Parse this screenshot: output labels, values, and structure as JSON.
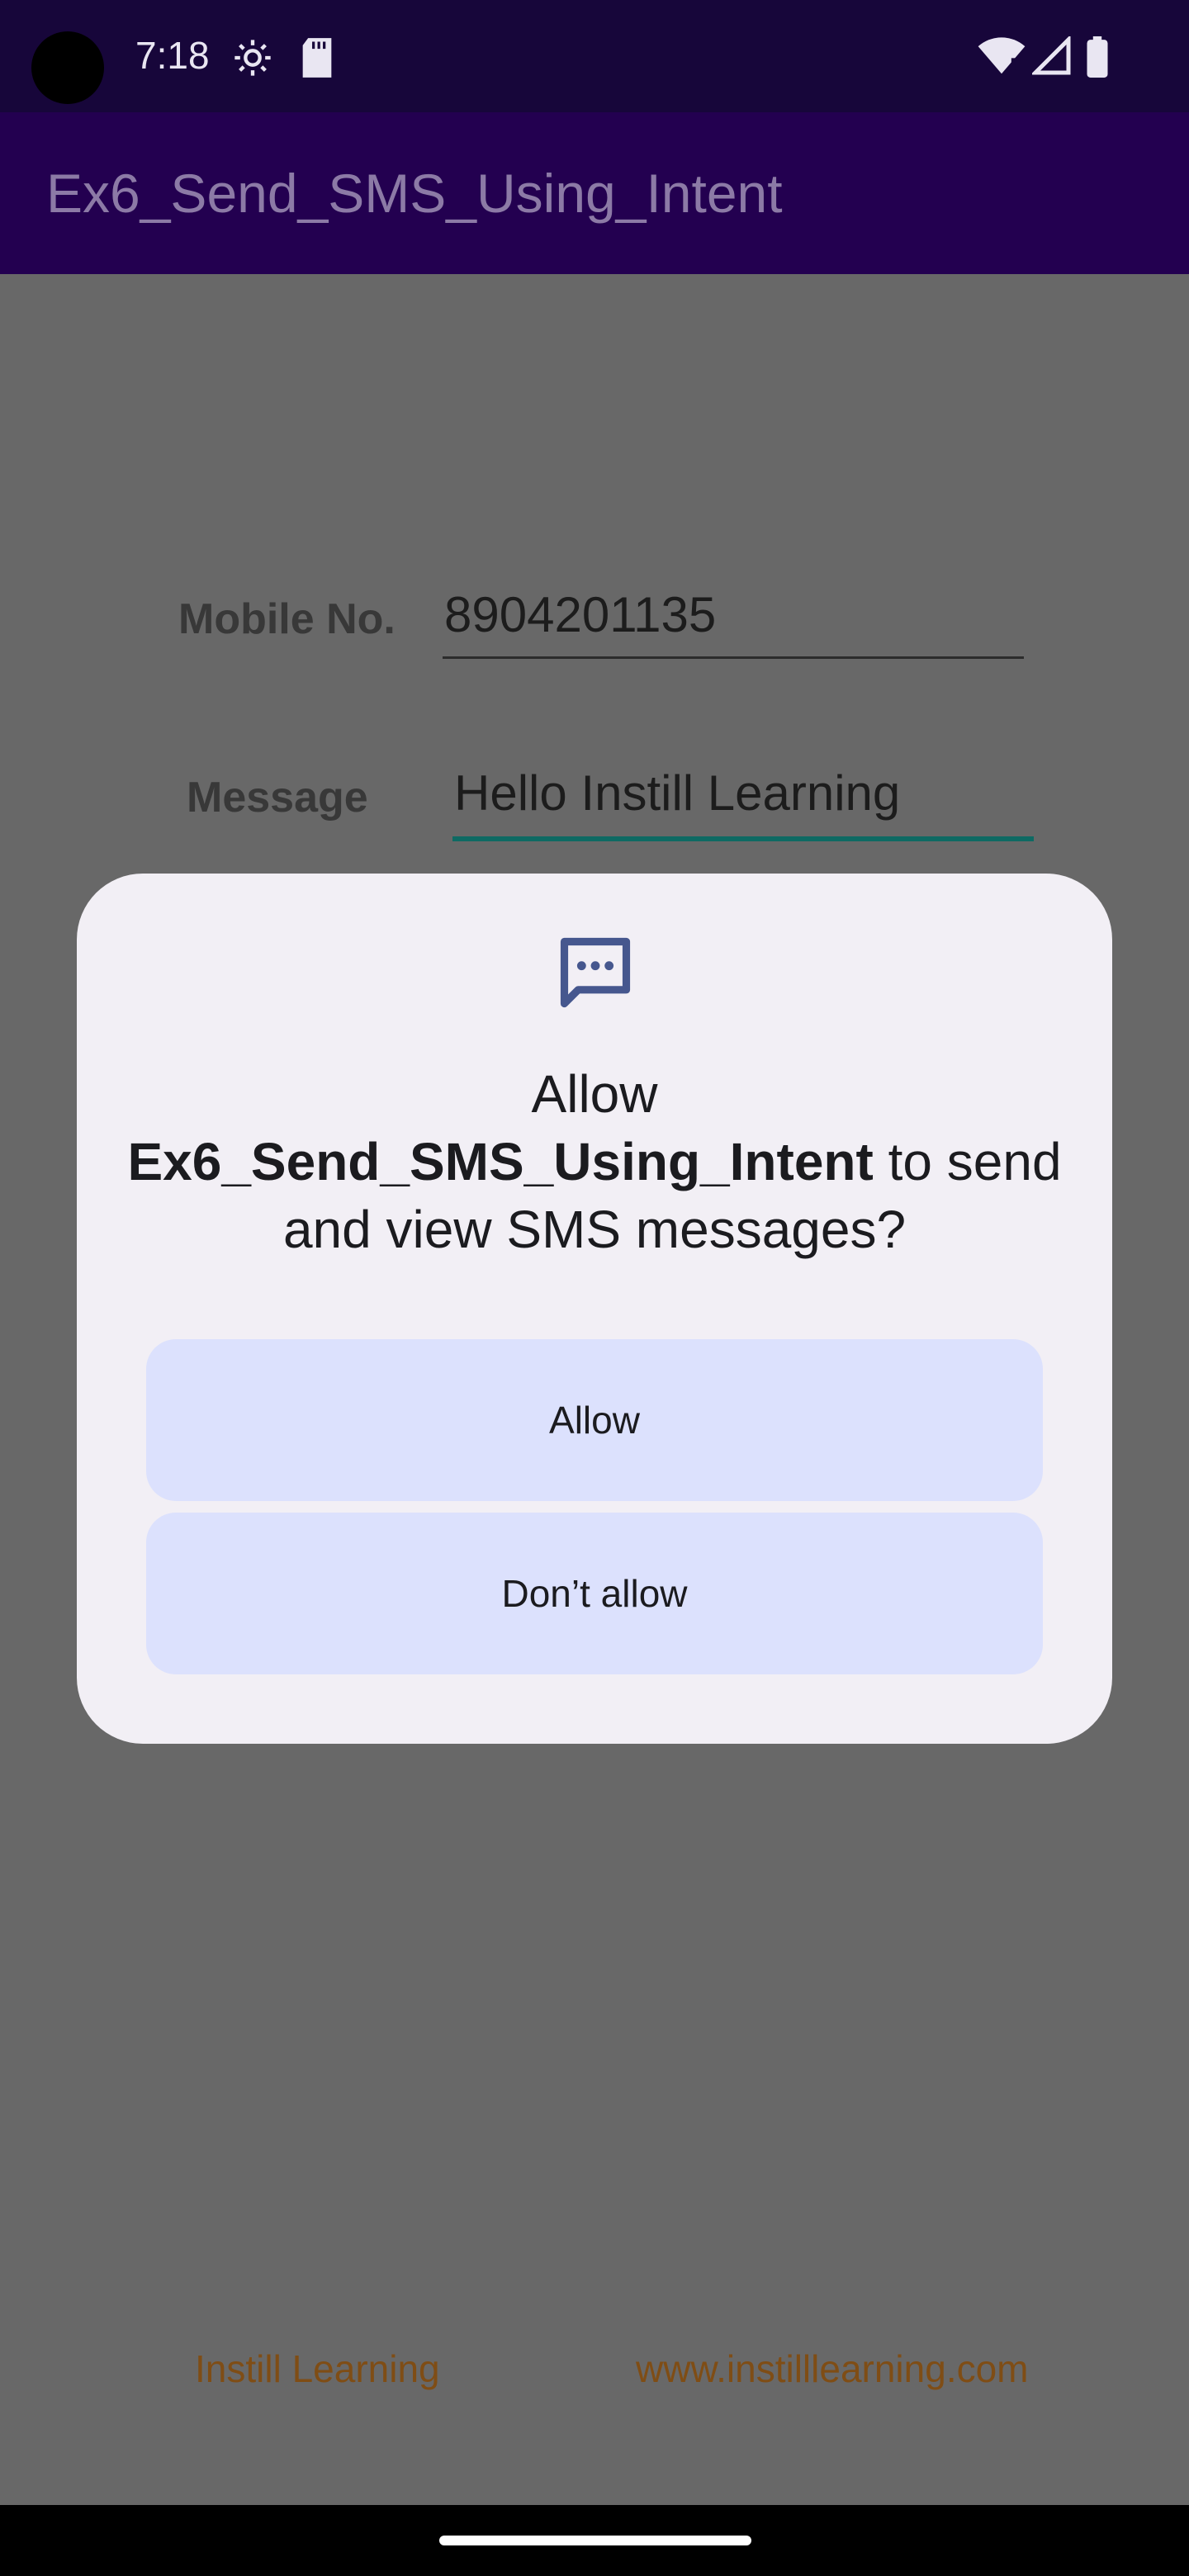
{
  "status_bar": {
    "time": "7:18",
    "icons": [
      "camera-cutout",
      "settings-gear-icon",
      "sd-card-icon",
      "wifi-icon",
      "cell-signal-icon",
      "battery-icon"
    ]
  },
  "app_bar": {
    "title": "Ex6_Send_SMS_Using_Intent"
  },
  "form": {
    "mobile_label": "Mobile No.",
    "mobile_value": "8904201135",
    "message_label": "Message",
    "message_value": "Hello Instill Learning"
  },
  "footer": {
    "left_link": "Instill Learning",
    "right_link": "www.instilllearning.com"
  },
  "dialog": {
    "icon": "sms-icon",
    "title_prefix": "Allow",
    "title_app": "Ex6_Send_SMS_Using_Intent",
    "title_suffix": " to send and view SMS messages?",
    "allow_label": "Allow",
    "deny_label": "Don’t allow"
  },
  "colors": {
    "status_bar": "#17063a",
    "app_bar": "#230050",
    "scrim_background": "#686868",
    "dialog_background": "#f2eff5",
    "button_background": "#dce1fd",
    "footer_link": "#7f4d15",
    "focus_underline": "#0e6a63"
  }
}
